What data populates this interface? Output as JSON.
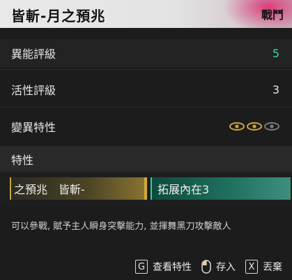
{
  "header": {
    "title": "皆斬-月之預兆",
    "tag": "戰鬥"
  },
  "ratings": [
    {
      "label": "異能評級",
      "value": "5",
      "accent": "#37d6b0"
    },
    {
      "label": "活性評級",
      "value": "3"
    },
    {
      "label": "變異特性",
      "eyes": {
        "active": 2,
        "total": 3,
        "active_color": "#c9a43a",
        "inactive_color": "#7a7a7a"
      }
    }
  ],
  "traits": {
    "title": "特性",
    "chips": [
      {
        "text": "之預兆　皆斬-",
        "style": "gold",
        "color": "#c9a43a"
      },
      {
        "text": "拓展內在3",
        "style": "teal",
        "color": "#2ad0a5"
      }
    ],
    "description": "可以參戰, 賦予主人瞬身突擊能力, 並揮舞黑刀攻擊敵人"
  },
  "controls": [
    {
      "key": "G",
      "label": "查看特性",
      "icon": "g-key-icon"
    },
    {
      "key": "",
      "label": "存入",
      "icon": "mouse-icon"
    },
    {
      "key": "X",
      "label": "丟棄",
      "icon": "x-key-icon"
    }
  ]
}
